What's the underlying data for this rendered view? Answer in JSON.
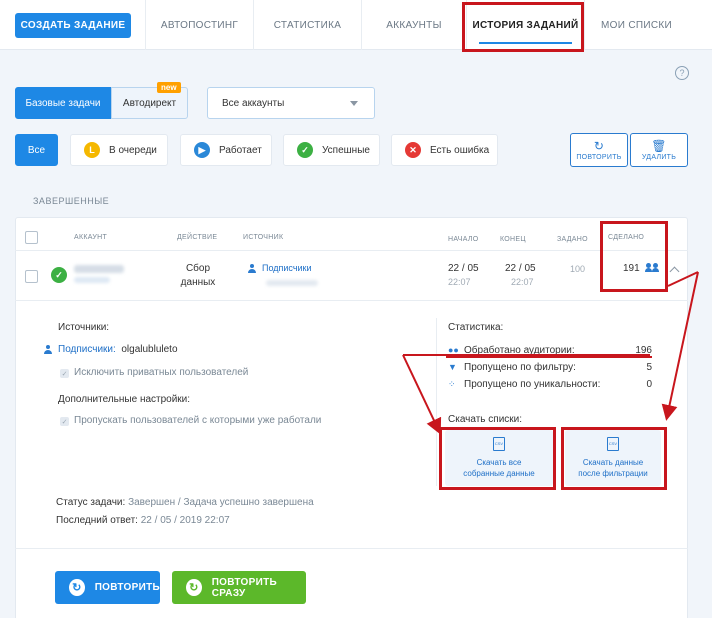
{
  "nav": {
    "create": "СОЗДАТЬ ЗАДАНИЕ",
    "tabs": [
      "АВТОПОСТИНГ",
      "СТАТИСТИКА",
      "АККАУНТЫ",
      "ИСТОРИЯ ЗАДАНИЙ",
      "МОИ СПИСКИ"
    ]
  },
  "help": "?",
  "mode": {
    "basic": "Базовые задачи",
    "auto": "Автодирект",
    "badge": "new"
  },
  "accounts_select": "Все аккаунты",
  "filters": {
    "all": "Все",
    "queue": "В очереди",
    "running": "Работает",
    "success": "Успешные",
    "error": "Есть ошибка"
  },
  "actions": {
    "repeat": "ПОВТОРИТЬ",
    "delete": "УДАЛИТЬ"
  },
  "section": "ЗАВЕРШЕННЫЕ",
  "table": {
    "headers": {
      "account": "АККАУНТ",
      "action": "ДЕЙСТВИЕ",
      "source": "ИСТОЧНИК",
      "start": "НАЧАЛО",
      "end": "КОНЕЦ",
      "set": "ЗАДАНО",
      "done": "СДЕЛАНО"
    },
    "row": {
      "action": "Сбор данных",
      "source": "Подписчики",
      "start_date": "22 / 05",
      "start_time": "22:07",
      "end_date": "22 / 05",
      "end_time": "22:07",
      "set": "100",
      "done": "191"
    }
  },
  "details": {
    "sources_title": "Источники:",
    "source_type": "Подписчики:",
    "source_value": "olgalubluleto",
    "exclude_private": "Исключить приватных пользователей",
    "extra_title": "Дополнительные настройки:",
    "skip_worked": "Пропускать пользователей с которыми уже работали",
    "status_label": "Статус задачи:",
    "status_value": "Завершен / Задача успешно завершена",
    "last_label": "Последний ответ:",
    "last_value": "22 / 05 / 2019 22:07"
  },
  "stats": {
    "title": "Статистика:",
    "rows": [
      {
        "label": "Обработано аудитории:",
        "value": "196"
      },
      {
        "label": "Пропущено по фильтру:",
        "value": "5"
      },
      {
        "label": "Пропущено по уникальности:",
        "value": "0"
      }
    ]
  },
  "downloads": {
    "title": "Скачать списки:",
    "all": "Скачать все собранные данные",
    "filtered": "Скачать данные после фильтрации",
    "file_tag": "CSV"
  },
  "buttons": {
    "repeat": "ПОВТОРИТЬ",
    "repeat_now": "ПОВТОРИТЬ СРАЗУ"
  },
  "colors": {
    "primary": "#1e88e5",
    "green": "#3cb043",
    "highlight": "#c8161d",
    "queue": "#f5b800",
    "running": "#2a88d8",
    "error": "#e53935"
  }
}
